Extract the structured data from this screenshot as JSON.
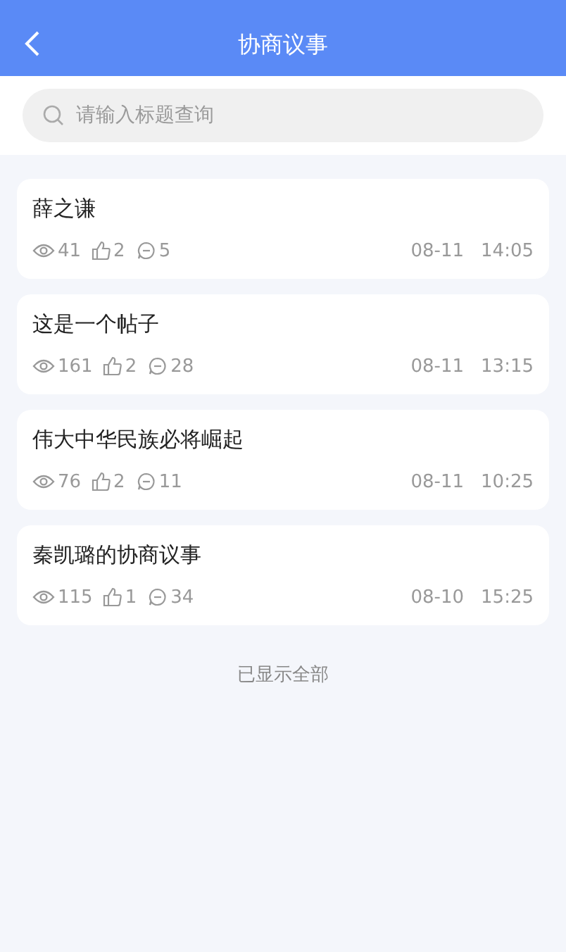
{
  "header": {
    "title": "协商议事"
  },
  "search": {
    "placeholder": "请输入标题查询"
  },
  "posts": [
    {
      "title": "薛之谦",
      "views": "41",
      "likes": "2",
      "comments": "5",
      "date": "08-11",
      "time": "14:05"
    },
    {
      "title": "这是一个帖子",
      "views": "161",
      "likes": "2",
      "comments": "28",
      "date": "08-11",
      "time": "13:15"
    },
    {
      "title": "伟大中华民族必将崛起",
      "views": "76",
      "likes": "2",
      "comments": "11",
      "date": "08-11",
      "time": "10:25"
    },
    {
      "title": "秦凯璐的协商议事",
      "views": "115",
      "likes": "1",
      "comments": "34",
      "date": "08-10",
      "time": "15:25"
    }
  ],
  "footer": {
    "text": "已显示全部"
  }
}
